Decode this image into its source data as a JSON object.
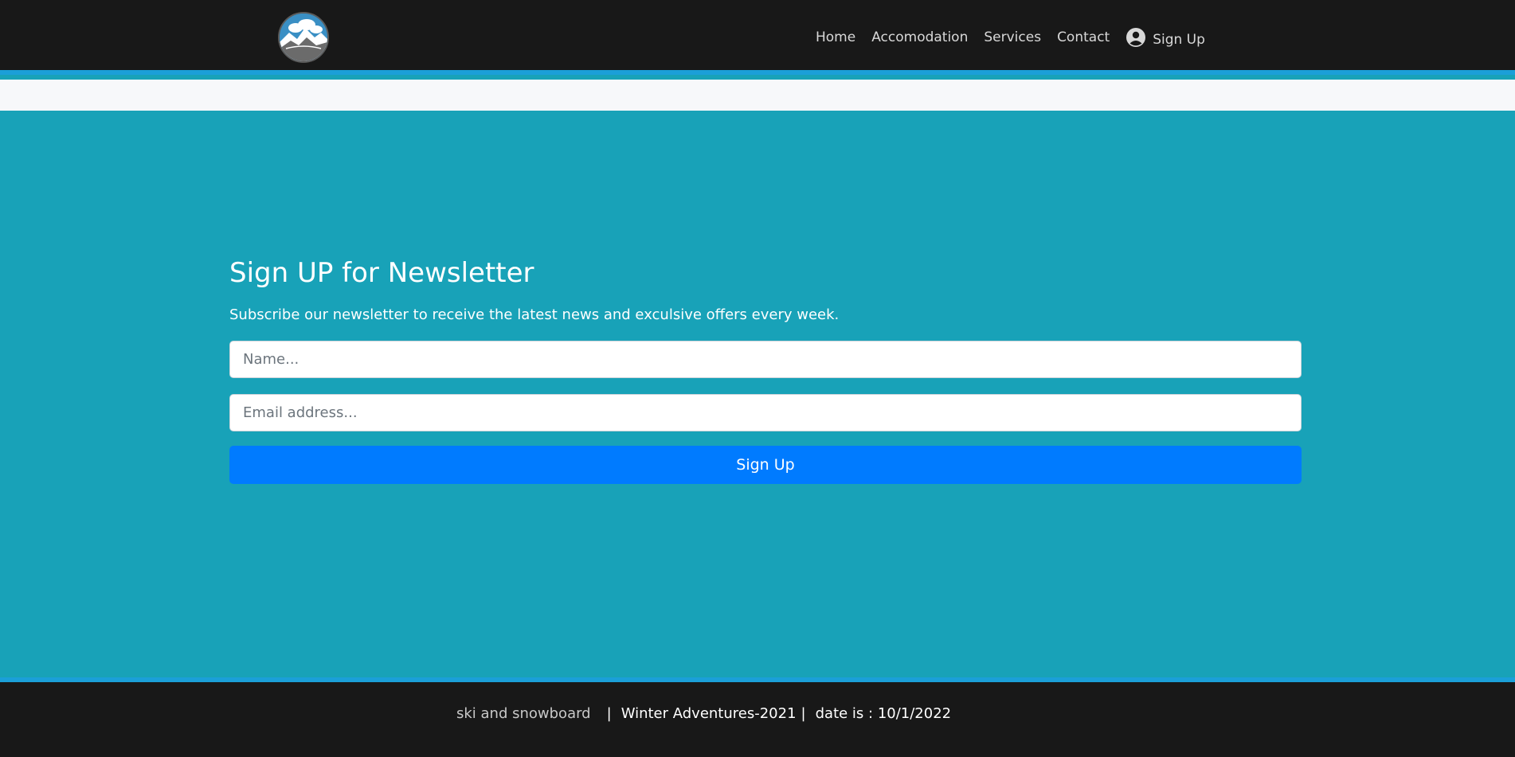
{
  "nav": {
    "items": [
      {
        "label": "Home"
      },
      {
        "label": "Accomodation"
      },
      {
        "label": "Services"
      },
      {
        "label": "Contact"
      }
    ],
    "signup_label": "Sign Up",
    "signup_icon": "user-circle-icon",
    "logo_text": "Winter Adventures"
  },
  "newsletter": {
    "title": "Sign UP for Newsletter",
    "subtitle": "Subscribe our newsletter to receive the latest news and exculsive offers every week.",
    "name_placeholder": "Name...",
    "name_value": "",
    "email_placeholder": "Email address...",
    "email_value": "",
    "button_label": "Sign Up"
  },
  "footer": {
    "tagline": "ski and snowboard",
    "separator": "|",
    "brand": "Winter Adventures-2021",
    "date_text": "date is : 10/1/2022"
  },
  "colors": {
    "navbar_bg": "#181818",
    "accent_border": "#1b9fd8",
    "page_bg": "#18a2b8",
    "button_bg": "#007bff"
  }
}
